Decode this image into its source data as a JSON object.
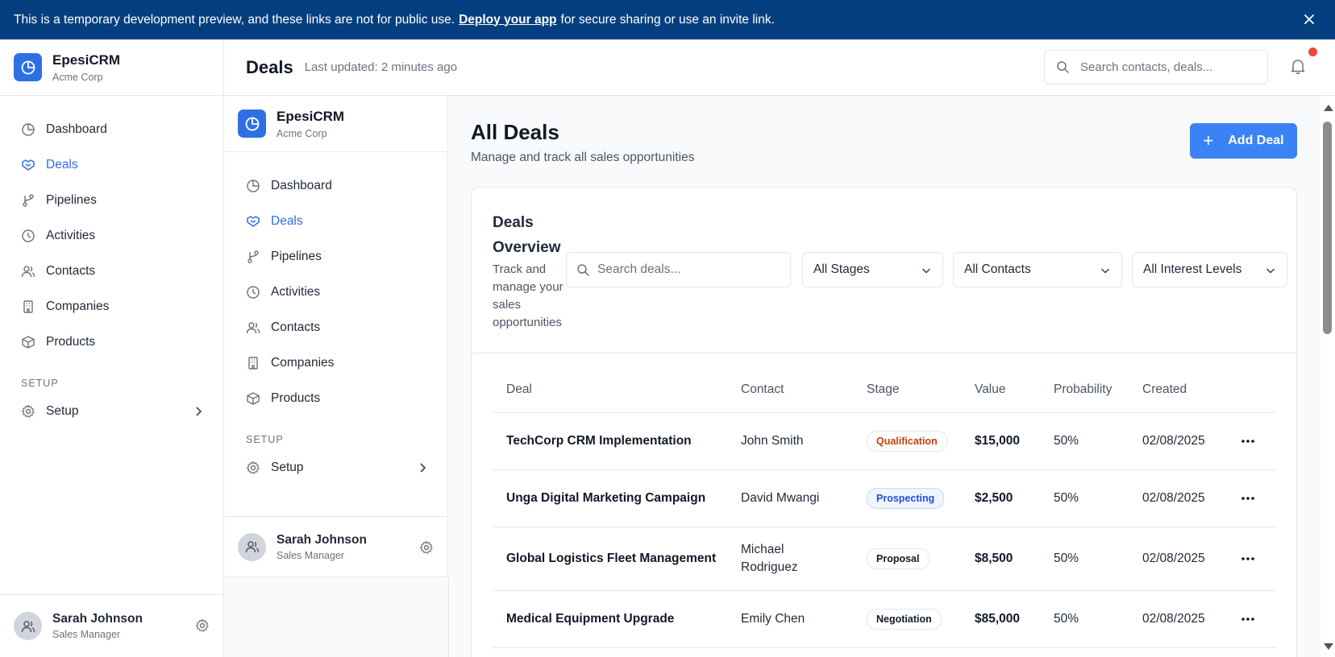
{
  "banner": {
    "text_before": "This is a temporary development preview, and these links are not for public use.",
    "link": "Deploy your app",
    "text_after": "for secure sharing or use an invite link."
  },
  "brand": {
    "name": "EpesiCRM",
    "org": "Acme Corp"
  },
  "sidebar": {
    "items": [
      {
        "label": "Dashboard",
        "icon": "dashboard-icon"
      },
      {
        "label": "Deals",
        "icon": "handshake-icon",
        "active": true
      },
      {
        "label": "Pipelines",
        "icon": "git-branch-icon"
      },
      {
        "label": "Activities",
        "icon": "clock-icon"
      },
      {
        "label": "Contacts",
        "icon": "users-icon"
      },
      {
        "label": "Companies",
        "icon": "building-icon"
      },
      {
        "label": "Products",
        "icon": "box-icon"
      }
    ],
    "setup_heading": "SETUP",
    "setup_label": "Setup"
  },
  "user": {
    "name": "Sarah Johnson",
    "role": "Sales Manager"
  },
  "header": {
    "title": "Deals",
    "last_updated_label": "Last updated:",
    "last_updated_value": "2 minutes ago",
    "search_placeholder": "Search contacts, deals..."
  },
  "main": {
    "title": "All Deals",
    "subtitle": "Manage and track all sales opportunities",
    "add_button": "Add Deal",
    "overview_title": "Deals Overview",
    "overview_desc": "Track and manage your sales opportunities",
    "search_placeholder": "Search deals...",
    "filters": [
      "All Stages",
      "All Contacts",
      "All Interest Levels"
    ]
  },
  "table": {
    "columns": [
      "Deal",
      "Contact",
      "Stage",
      "Value",
      "Probability",
      "Created"
    ],
    "rows": [
      {
        "deal": "TechCorp CRM Implementation",
        "contact": "John Smith",
        "stage": "Qualification",
        "value": "$15,000",
        "probability": "50%",
        "created": "02/08/2025"
      },
      {
        "deal": "Unga Digital Marketing Campaign",
        "contact": "David Mwangi",
        "stage": "Prospecting",
        "value": "$2,500",
        "probability": "50%",
        "created": "02/08/2025"
      },
      {
        "deal": "Global Logistics Fleet Management",
        "contact": "Michael Rodriguez",
        "stage": "Proposal",
        "value": "$8,500",
        "probability": "50%",
        "created": "02/08/2025"
      },
      {
        "deal": "Medical Equipment Upgrade",
        "contact": "Emily Chen",
        "stage": "Negotiation",
        "value": "$85,000",
        "probability": "50%",
        "created": "02/08/2025"
      }
    ]
  },
  "colors": {
    "banner": "#063f7f",
    "accent": "#2f6fe4",
    "button": "#3b82f6",
    "stage_qualification": "#c2410c",
    "stage_prospecting": "#1d4ed8",
    "stage_prospecting_bg": "#eff6ff",
    "notification_dot": "#ef4444"
  }
}
